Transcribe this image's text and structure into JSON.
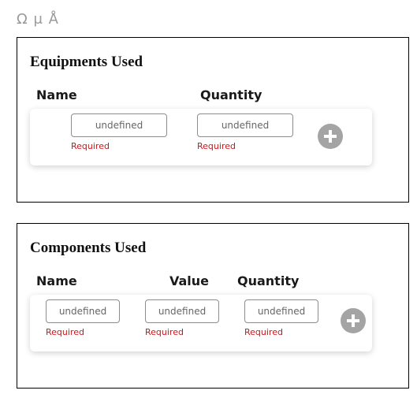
{
  "header": {
    "symbols": "Ω μ Å"
  },
  "equipments": {
    "title": "Equipments Used",
    "columns": {
      "name": "Name",
      "quantity": "Quantity"
    },
    "row": {
      "name_value": "undefined",
      "name_error": "Required",
      "quantity_value": "undefined",
      "quantity_error": "Required"
    },
    "add_icon": "plus-circle-icon"
  },
  "components": {
    "title": "Components Used",
    "columns": {
      "name": "Name",
      "value": "Value",
      "quantity": "Quantity"
    },
    "row": {
      "name_value": "undefined",
      "name_error": "Required",
      "value_value": "undefined",
      "value_error": "Required",
      "quantity_value": "undefined",
      "quantity_error": "Required"
    },
    "add_icon": "plus-circle-icon"
  },
  "colors": {
    "error": "#c6161b",
    "add_button": "#a4a4a4",
    "symbols": "#9a9a9a"
  }
}
